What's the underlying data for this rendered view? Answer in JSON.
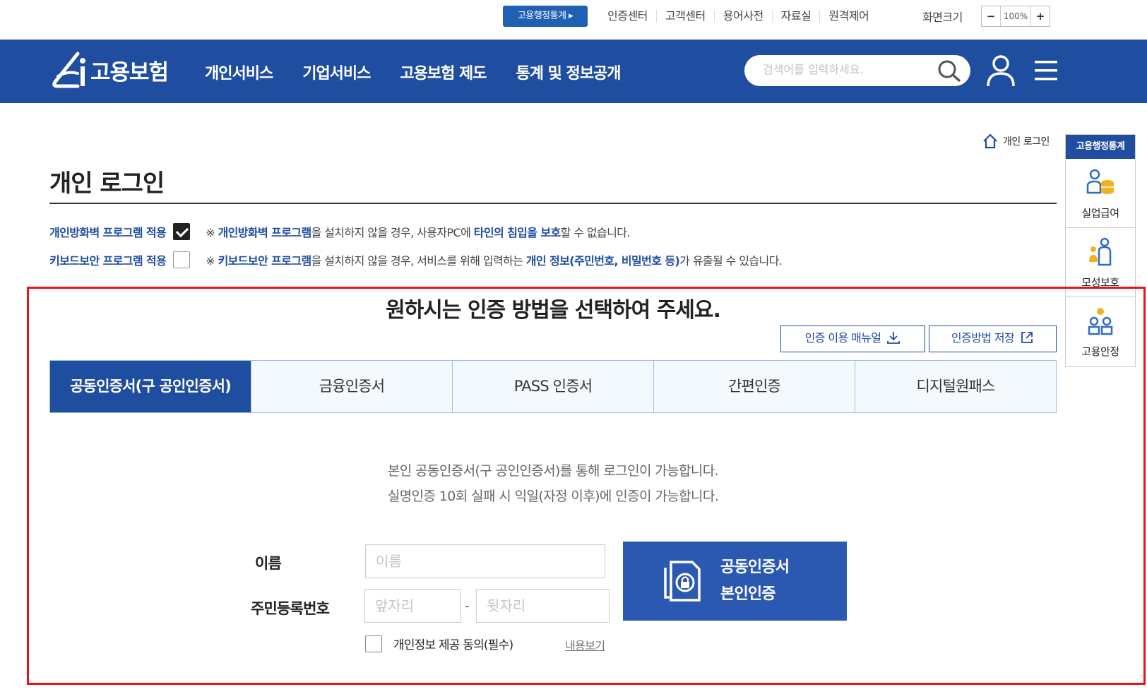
{
  "utility": {
    "stats_button": "고용행정통계 ▸",
    "links": [
      "인증센터",
      "고객센터",
      "용어사전",
      "자료실",
      "원격제어"
    ],
    "zoom_label": "화면크기",
    "zoom_minus": "−",
    "zoom_value": "100%",
    "zoom_plus": "+"
  },
  "gnb": {
    "logo_text": "고용보험",
    "menu": [
      "개인서비스",
      "기업서비스",
      "고용보험 제도",
      "통계 및 정보공개"
    ],
    "search_placeholder": "검색어를 입력하세요."
  },
  "breadcrumb": {
    "current": "개인 로그인"
  },
  "quick_menu": {
    "header": "고용행정통계",
    "items": [
      "실업급여",
      "모성보호",
      "고용안정"
    ]
  },
  "page": {
    "title": "개인 로그인",
    "firewall": {
      "label": "개인방화벽 프로그램 적용",
      "checked": true,
      "note_prefix": "※ ",
      "note_link1": "개인방화벽 프로그램",
      "note_mid": "을 설치하지 않을 경우, 사용자PC에 ",
      "note_link2": "타인의 침입을 보호",
      "note_suffix": "할 수 없습니다."
    },
    "keyboard": {
      "label": "키보드보안 프로그램 적용",
      "checked": false,
      "note_prefix": "※ ",
      "note_link1": "키보드보안 프로그램",
      "note_mid": "을 설치하지 않을 경우, 서비스를 위해 입력하는 ",
      "note_link2": "개인 정보(주민번호, 비밀번호 등)",
      "note_suffix": "가 유출될 수 있습니다."
    }
  },
  "auth": {
    "title": "원하시는 인증 방법을 선택하여 주세요.",
    "manual_button": "인증 이용 매뉴얼",
    "save_button": "인증방법 저장",
    "tabs": [
      "공동인증서(구 공인인증서)",
      "금융인증서",
      "PASS 인증서",
      "간편인증",
      "디지털원패스"
    ],
    "active_tab": 0,
    "desc_line1": "본인 공동인증서(구 공인인증서)를 통해 로그인이 가능합니다.",
    "desc_line2": "실명인증 10회 실패 시 익일(자정 이후)에 인증이 가능합니다.",
    "name_label": "이름",
    "name_placeholder": "이름",
    "rrn_label": "주민등록번호",
    "rrn_front_placeholder": "앞자리",
    "rrn_separator": "-",
    "rrn_back_placeholder": "뒷자리",
    "consent_label": "개인정보 제공 동의(필수)",
    "view_link": "내용보기",
    "cert_button_line1": "공동인증서",
    "cert_button_line2": "본인인증"
  },
  "colors": {
    "primary": "#1f4da0",
    "highlight_frame": "#e8141a",
    "tab_bg": "#f4f9fe"
  }
}
